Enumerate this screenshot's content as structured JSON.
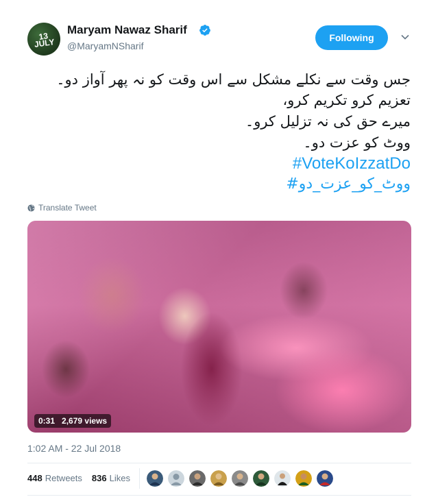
{
  "author": {
    "name": "Maryam Nawaz Sharif",
    "handle": "@MaryamNSharif",
    "avatar_text": "13 JULY",
    "verified": true
  },
  "follow_button": {
    "label": "Following",
    "color": "#1da1f2"
  },
  "tweet": {
    "lines": [
      "جس وقت سے نکلے مشکل سے اس وقت کو نہ پھر آواز دو۔",
      "تعزیم کرو تکریم کرو،",
      "میرے حق کی نہ تزلیل کرو۔",
      "ووٹ کو عزت دو۔"
    ],
    "hashtags": [
      "#VoteKoIzzatDo",
      "#ووٹ_کو_عزت_دو"
    ],
    "translate_label": "Translate Tweet"
  },
  "video": {
    "duration": "0:31",
    "views": "2,679 views"
  },
  "timestamp": "1:02 AM - 22 Jul 2018",
  "stats": {
    "retweets_count": "448",
    "retweets_label": "Retweets",
    "likes_count": "836",
    "likes_label": "Likes"
  },
  "colors": {
    "accent": "#1da1f2",
    "secondary_text": "#657786",
    "border": "#e6ecf0"
  },
  "icons": [
    "verified-badge-icon",
    "chevron-down-icon",
    "globe-icon"
  ]
}
